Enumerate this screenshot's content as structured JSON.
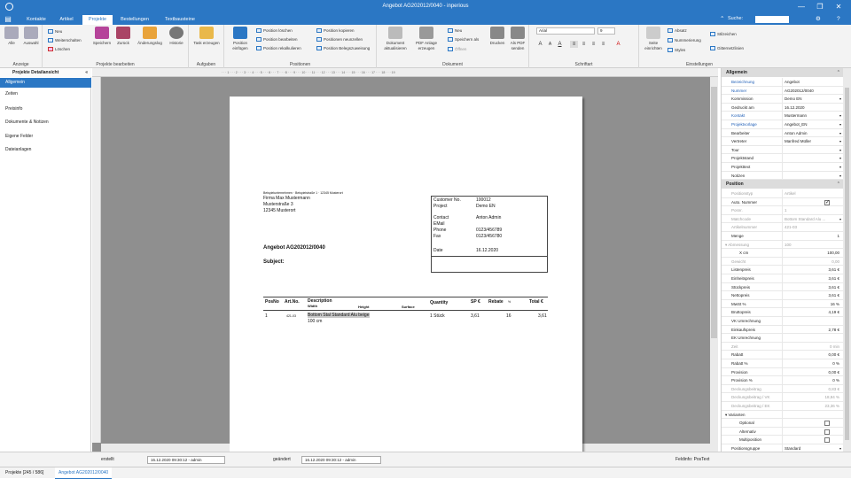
{
  "window": {
    "title": "Angebot AG202012/0040 - inperious",
    "min": "—",
    "max": "❐",
    "close": "✕"
  },
  "tabs": [
    {
      "label": "Kontakte"
    },
    {
      "label": "Artikel"
    },
    {
      "label": "Projekte"
    },
    {
      "label": "Bestellungen"
    },
    {
      "label": "Textbausteine"
    }
  ],
  "search": {
    "label": "Suche:",
    "value": ""
  },
  "ribbon": {
    "anzeige": {
      "label": "Anzeige",
      "alle": "Alle",
      "auswahl": "Auswahl"
    },
    "projekt": {
      "label": "Projekte bearbeiten",
      "neu": "Neu",
      "weiterschalten": "Weiterschalten",
      "loeschen": "Löschen",
      "speichern": "Speichern",
      "zurueck": "Zurück",
      "aenderungslog": "Änderungslog",
      "historie": "Historie"
    },
    "aufgaben": {
      "label": "Aufgaben",
      "task": "Task erzeugen"
    },
    "positionen": {
      "label": "Positionen",
      "einfuegen": "Position einfügen",
      "loeschen": "Position löschen",
      "bearbeiten": "Position bearbeiten",
      "rekalk": "Position rekalkulieren",
      "kopieren": "Position kopieren",
      "neu": "Positionen neunzellen",
      "bel": "Position Belegszuweisung"
    },
    "dokument": {
      "label": "Dokument",
      "aktualisieren": "Dokument aktualisieren",
      "anlage": "PDF Anlage erzeugen",
      "neu": "Neu",
      "speichern_als": "Speichern als",
      "oeffnen": "Öffnen",
      "drucken": "Drucken",
      "pdf": "Als PDF senden"
    },
    "schrift": {
      "label": "Schriftart",
      "font": "Arial",
      "size": "9"
    },
    "einstellungen": {
      "label": "Einstellungen",
      "seite": "Seite einrichten",
      "absatz": "Absatz",
      "nummerierung": "Nummerierung",
      "styles": "Styles",
      "stil": "Stilzeichen",
      "gitter": "Gitternetzlinien"
    }
  },
  "sidebar": {
    "title": "Projekte Detailansicht",
    "items": [
      {
        "label": "Allgemein"
      },
      {
        "label": "Zeiten"
      },
      {
        "label": "Preisinfo"
      },
      {
        "label": "Dokumente & Notizen"
      },
      {
        "label": "Eigene Felder"
      },
      {
        "label": "Dateianlagen"
      }
    ]
  },
  "ruler": "· · · 1 · · · 2 · · · 3 · · · 4 · · · 5 · · · 6 · · · 7 · · · 8 · · · 9 · · · 10 · · · 11 · · · 12 · · · 13 · · · 14 · · · 15 · · · 16 · · · 17 · · · 18 · · · 19",
  "document": {
    "sender": "Beispielunternehmen · Beispielstraße 1 · 12345 Musterort",
    "recipient": [
      "Firma Max Mustermann",
      "Musterstraße 3",
      "12345 Musterort"
    ],
    "info": [
      {
        "k": "Customer No.",
        "v": "100012"
      },
      {
        "k": "Project",
        "v": "Demo EN"
      },
      {
        "k": "Contact",
        "v": "Anton Admin"
      },
      {
        "k": "EMail",
        "v": ""
      },
      {
        "k": "Phone",
        "v": "0123/456789"
      },
      {
        "k": "Fax",
        "v": "0123/456780"
      },
      {
        "k": "Date",
        "v": "16.12.2020"
      }
    ],
    "title": "Angebot AG202012/0040",
    "subject": "Subject:",
    "cols": {
      "posno": "PosNo",
      "artno": "Art.No.",
      "desc": "Description",
      "width": "Width",
      "height": "Height",
      "surface": "Surface",
      "qty": "Quantity",
      "sp": "SP €",
      "rebate": "Rebate",
      "pct": "%",
      "total": "Total €"
    },
    "row": {
      "posno": "1",
      "artno": "421-03",
      "desc": "Bottom Stal Standard Alu beige",
      "dim": "100 cm",
      "qty": "1 Stück",
      "sp": "3,61",
      "rebate": "16",
      "total": "3,61"
    }
  },
  "props": {
    "allgemein": {
      "title": "Allgemein",
      "rows": [
        {
          "k": "Bezeichnung",
          "v": "Angebot"
        },
        {
          "k": "Nummer",
          "v": "AG202012/0040"
        },
        {
          "k": "Kommission",
          "v": "Demo EN"
        },
        {
          "k": "Gedruckt am",
          "v": "16.12.2020"
        },
        {
          "k": "Kontakt",
          "v": "Mustermann"
        },
        {
          "k": "Projektvorlage",
          "v": "Angebot_EN"
        },
        {
          "k": "Bearbeiter",
          "v": "Anton Admin"
        },
        {
          "k": "Vertreter",
          "v": "Manfred Müller"
        },
        {
          "k": "Tour",
          "v": ""
        },
        {
          "k": "Projektstand",
          "v": ""
        },
        {
          "k": "Projekttext",
          "v": ""
        },
        {
          "k": "Notizen",
          "v": ""
        }
      ]
    },
    "position": {
      "title": "Position",
      "rows": [
        {
          "k": "Positionstyp",
          "v": "Artikel"
        },
        {
          "k": "Auto. Nummer",
          "v": ""
        },
        {
          "k": "Posnr.",
          "v": "1"
        },
        {
          "k": "Matchcode",
          "v": "Bottom Standard Alu ..."
        },
        {
          "k": "Artikelnummer",
          "v": "421-03"
        },
        {
          "k": "Menge",
          "v": "1"
        },
        {
          "k": "Abmessung",
          "v": "100"
        },
        {
          "k": "X cm",
          "v": "100,00"
        },
        {
          "k": "Gewicht",
          "v": "0,00"
        },
        {
          "k": "Listenpreis",
          "v": "3,61 €"
        },
        {
          "k": "Einheitspreis",
          "v": "3,61 €"
        },
        {
          "k": "Stückpreis",
          "v": "3,61 €"
        },
        {
          "k": "Nettopreis",
          "v": "3,61 €"
        },
        {
          "k": "MwSt %",
          "v": "16 %"
        },
        {
          "k": "Bruttopreis",
          "v": "4,19 €"
        },
        {
          "k": "VK Umrechnung",
          "v": ""
        },
        {
          "k": "Einkaufspreis",
          "v": "2,78 €"
        },
        {
          "k": "EK Umrechnung",
          "v": ""
        },
        {
          "k": "Zeit",
          "v": "0 min"
        },
        {
          "k": "Rabatt",
          "v": "0,00 €"
        },
        {
          "k": "Rabatt %",
          "v": "0 %"
        },
        {
          "k": "Provision",
          "v": "0,00 €"
        },
        {
          "k": "Provision %",
          "v": "0 %"
        },
        {
          "k": "Deckungsbeitrag",
          "v": "0,83 €"
        },
        {
          "k": "Deckungsbeitrag / VK",
          "v": "18,94 %"
        },
        {
          "k": "Deckungsbeitrag / EK",
          "v": "23,36 %"
        },
        {
          "k": "Varianten",
          "v": ""
        },
        {
          "k": "Optional",
          "v": ""
        },
        {
          "k": "Alternativ",
          "v": ""
        },
        {
          "k": "Multiposition",
          "v": ""
        },
        {
          "k": "Positionsgruppe",
          "v": "Standard"
        }
      ]
    }
  },
  "status": {
    "created_label": "erstellt",
    "created": "16.12.2020 09:30:12 - admin",
    "changed_label": "geändert",
    "changed": "16.12.2020 09:30:12 - admin",
    "feld": "Feldinfo: PosText"
  },
  "bottom": {
    "projekte": "Projekte [245 / 586]",
    "angebot": "Angebot AG202012/0040"
  }
}
